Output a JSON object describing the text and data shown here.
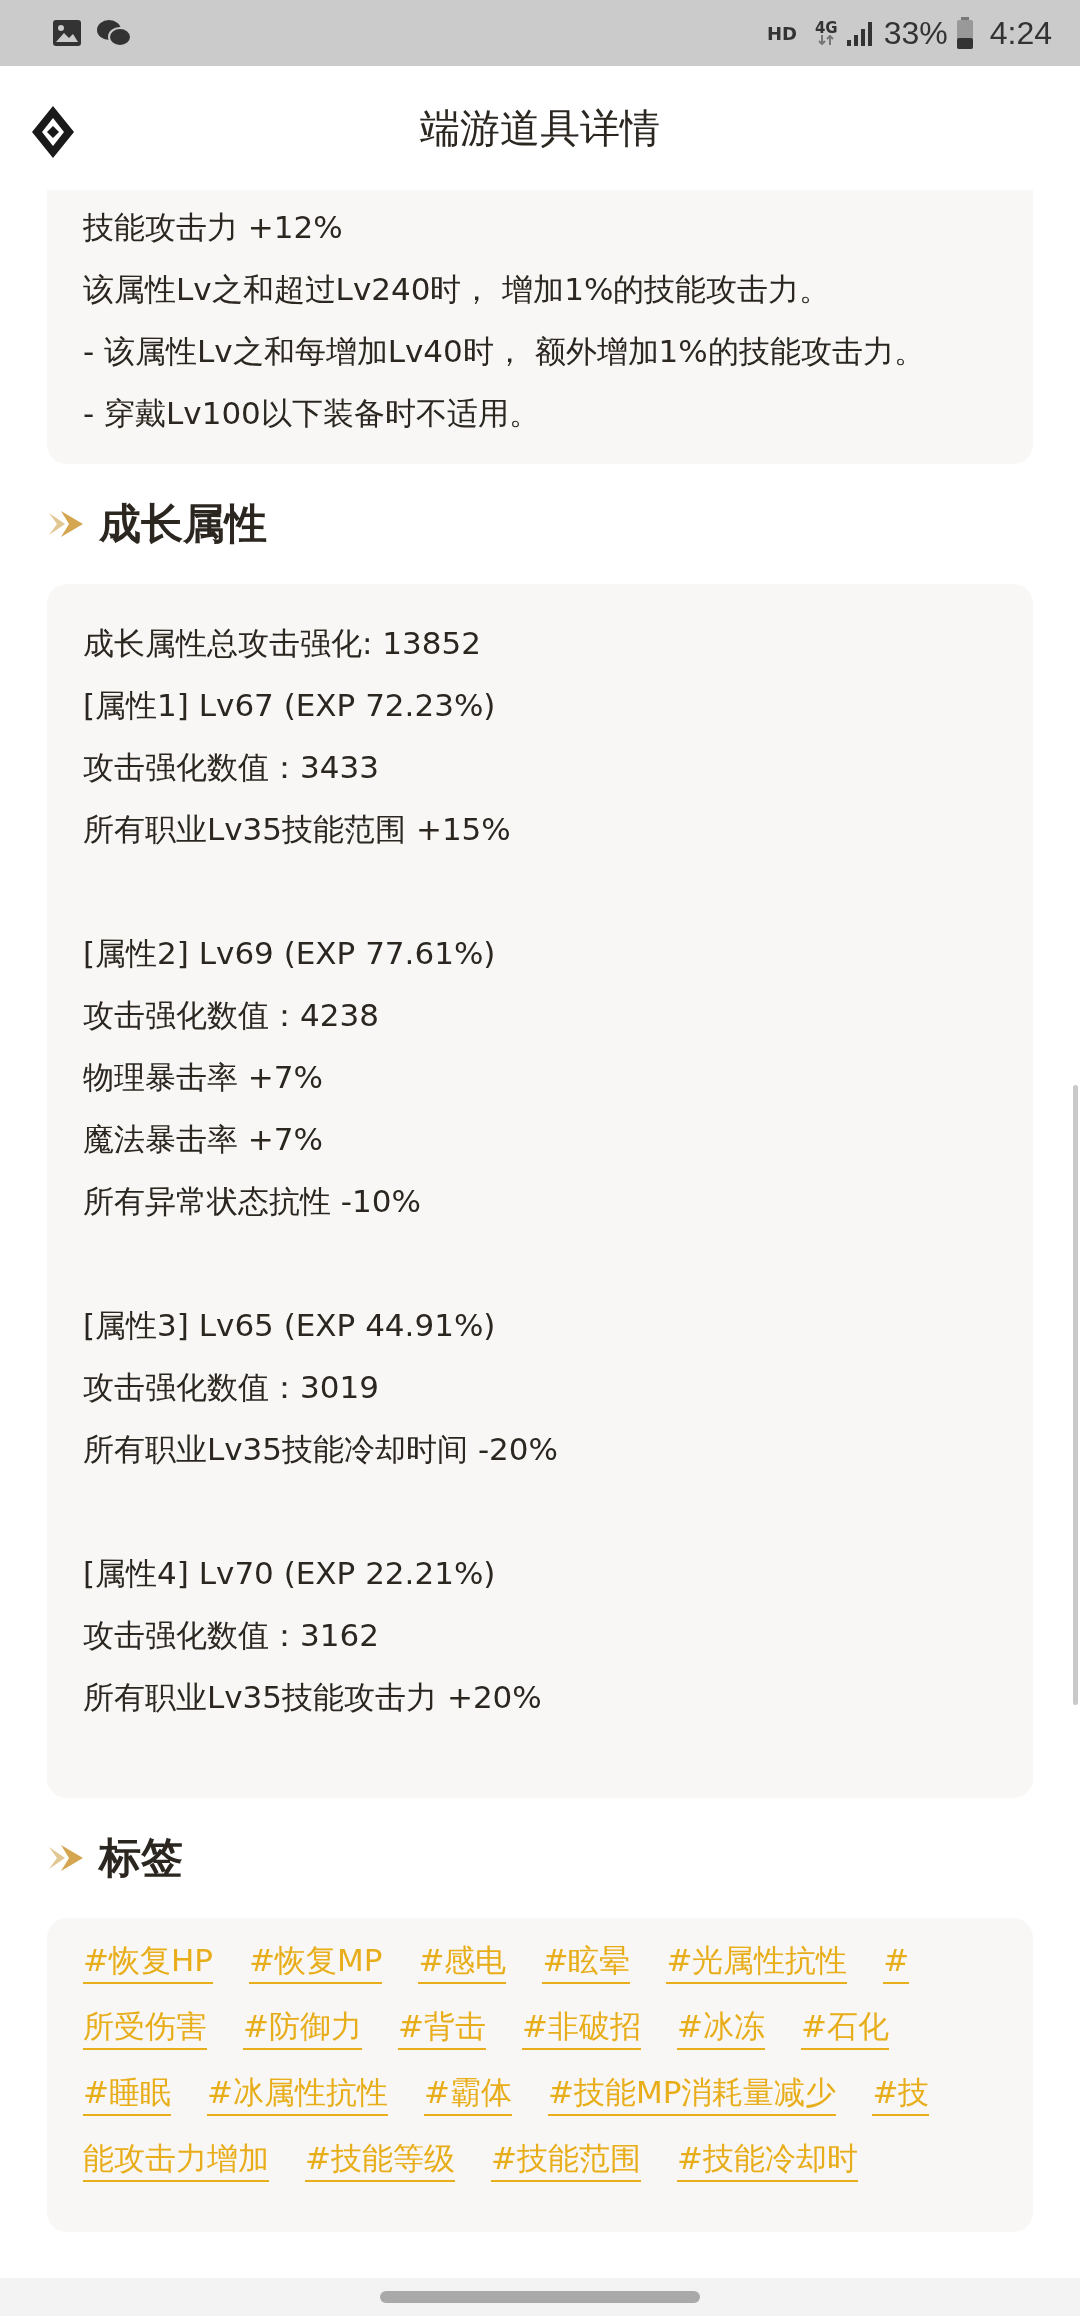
{
  "status_bar": {
    "network_badge": "HD",
    "network_type": "4G",
    "battery": "33%",
    "time": "4:24"
  },
  "header": {
    "title": "端游道具详情"
  },
  "top_card": {
    "lines": [
      "技能攻击力 +12%",
      "该属性Lv之和超过Lv240时， 增加1%的技能攻击力。",
      "- 该属性Lv之和每增加Lv40时， 额外增加1%的技能攻击力。",
      "- 穿戴Lv100以下装备时不适用。"
    ]
  },
  "sections": [
    {
      "kind": "text",
      "title": "成长属性",
      "paragraphs": [
        [
          "成长属性总攻击强化: 13852",
          "[属性1] Lv67 (EXP 72.23%)",
          "攻击强化数值：3433",
          "所有职业Lv35技能范围 +15%"
        ],
        [
          "[属性2] Lv69 (EXP 77.61%)",
          "攻击强化数值：4238",
          "物理暴击率 +7%",
          "魔法暴击率 +7%",
          "所有异常状态抗性 -10%"
        ],
        [
          "[属性3] Lv65 (EXP 44.91%)",
          "攻击强化数值：3019",
          "所有职业Lv35技能冷却时间 -20%"
        ],
        [
          "[属性4] Lv70 (EXP 22.21%)",
          "攻击强化数值：3162",
          "所有职业Lv35技能攻击力 +20%"
        ]
      ]
    },
    {
      "kind": "tags",
      "title": "标签",
      "tag_rows": [
        [
          "#恢复HP",
          "#恢复MP",
          "#感电",
          "#眩晕",
          "#光属性抗性",
          "#"
        ],
        [
          "所受伤害",
          "#防御力",
          "#背击",
          "#非破招",
          "#冰冻",
          "#石化"
        ],
        [
          "#睡眠",
          "#冰属性抗性",
          "#霸体",
          "#技能MP消耗量减少",
          "#技"
        ],
        [
          "能攻击力增加",
          "#技能等级",
          "#技能范围",
          "#技能冷却时"
        ]
      ]
    }
  ]
}
